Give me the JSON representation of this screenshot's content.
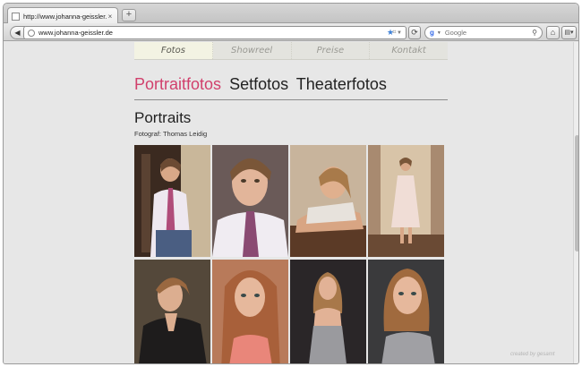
{
  "browser": {
    "tab_title": "http://www.johanna-geissler.de/",
    "tab_close": "×",
    "new_tab": "+",
    "back": "◀",
    "url": "www.johanna-geissler.de",
    "search_engine": "Google",
    "search_placeholder": "Google"
  },
  "site": {
    "nav": [
      "Fotos",
      "Showreel",
      "Preise",
      "Kontakt"
    ],
    "active_nav": "Fotos",
    "categories": [
      "Portraitfotos",
      "Setfotos",
      "Theaterfotos"
    ],
    "active_category": "Portraitfotos",
    "section_title": "Portraits",
    "photographer_credit": "Fotograf: Thomas Leidig",
    "accent_color": "#d1406c"
  },
  "gallery": {
    "rows": 2,
    "columns": 4,
    "photos": [
      "portrait-white-shirt-tie-doorway",
      "portrait-closeup-tie",
      "portrait-leaning-arms",
      "portrait-white-dress-standing",
      "portrait-leather-jacket",
      "portrait-long-hair-pink-top",
      "portrait-grey-dress-dark-background",
      "portrait-grey-dress-closeup"
    ]
  },
  "watermark": "created by gesamt"
}
